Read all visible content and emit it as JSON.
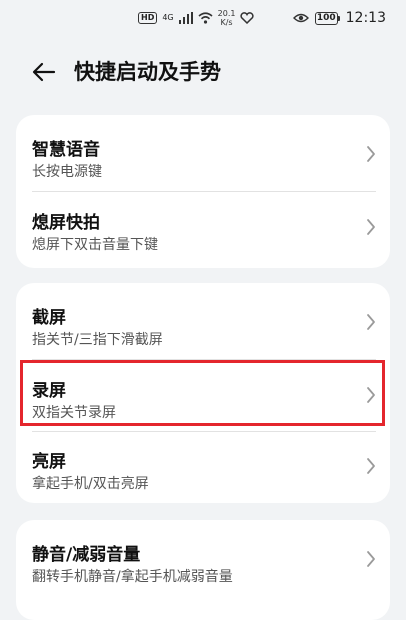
{
  "status_bar": {
    "hd": "HD",
    "network": "4G",
    "speed_value": "20.1",
    "speed_unit": "K/s",
    "battery": "100",
    "time": "12:13",
    "icons": [
      "hd-icon",
      "signal-icon",
      "wifi-icon",
      "heart-icon",
      "eye-icon",
      "battery-icon"
    ]
  },
  "header": {
    "title": "快捷启动及手势",
    "back_icon": "arrow-left-icon"
  },
  "groups": [
    {
      "items": [
        {
          "title": "智慧语音",
          "subtitle": "长按电源键"
        },
        {
          "title": "熄屏快拍",
          "subtitle": "熄屏下双击音量下键"
        }
      ]
    },
    {
      "items": [
        {
          "title": "截屏",
          "subtitle": "指关节/三指下滑截屏"
        },
        {
          "title": "录屏",
          "subtitle": "双指关节录屏"
        },
        {
          "title": "亮屏",
          "subtitle": "拿起手机/双击亮屏"
        }
      ]
    },
    {
      "items": [
        {
          "title": "静音/减弱音量",
          "subtitle": "翻转手机静音/拿起手机减弱音量"
        }
      ]
    }
  ],
  "highlight": {
    "color": "#e4262d",
    "target": "录屏"
  }
}
